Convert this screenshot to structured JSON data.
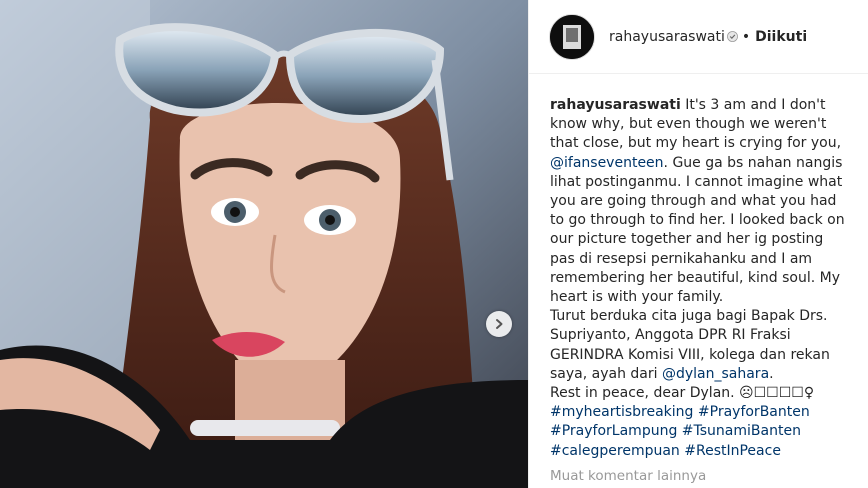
{
  "post": {
    "username": "rahayusaraswati",
    "separator": "•",
    "follow_status": "Diikuti"
  },
  "caption": {
    "username": "rahayusaraswati",
    "text_1": " It's 3 am and I don't know why, but even though we weren't that close, but my heart is crying for you, ",
    "mention_1": "@ifanseventeen",
    "text_2": ". Gue ga bs nahan nangis lihat postinganmu. I cannot imagine what you are going through and what you had to go through to find her. I looked back on our picture together and her ig posting pas di resepsi pernikahanku and I am remembering her beautiful, kind soul. My heart is with your family.",
    "text_3": "Turut berduka cita juga bagi Bapak Drs. Supriyanto, Anggota DPR RI Fraksi GERINDRA Komisi VIII, kolega dan rekan saya, ayah dari ",
    "mention_2": "@dylan_sahara",
    "text_4": ".",
    "text_5": "Rest in peace, dear Dylan. ☹☐☐☐☐♀",
    "hashtags_line_1": [
      "#myheartisbreaking",
      "#PrayforBanten"
    ],
    "hashtags_line_2": [
      "#PrayforLampung",
      "#TsunamiBanten"
    ],
    "hashtags_line_3": [
      "#calegperempuan",
      "#RestInPeace"
    ]
  },
  "comments": {
    "more_label": "Muat komentar lainnya"
  }
}
